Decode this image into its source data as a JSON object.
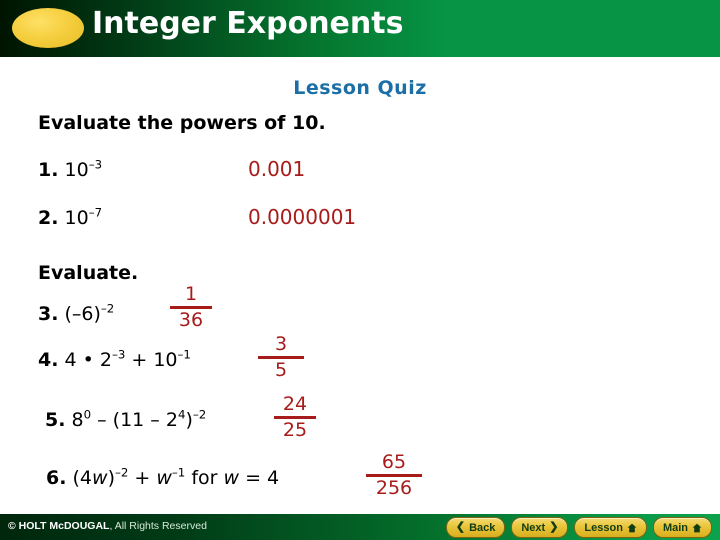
{
  "header": {
    "title": "Integer Exponents",
    "ellipse_color": "#f0c93c",
    "bar_color": "#079445"
  },
  "slide": {
    "subtitle": "Lesson Quiz",
    "subtitle_color": "#1b6fa6",
    "directions_1": "Evaluate the powers of 10.",
    "directions_2": "Evaluate.",
    "answer_color": "#a81b1b",
    "questions": [
      {
        "number": "1.",
        "expression_html": "10<sup>&#8211;3</sup>",
        "answer_type": "plain",
        "answer": "0.001"
      },
      {
        "number": "2.",
        "expression_html": "10<sup>&#8211;7</sup>",
        "answer_type": "plain",
        "answer": "0.0000001"
      },
      {
        "number": "3.",
        "expression_html": "(&#8211;6)<sup>&#8211;2</sup>",
        "answer_type": "fraction",
        "numerator": "1",
        "denominator": "36"
      },
      {
        "number": "4.",
        "expression_html": "4 &#8226; 2<sup>&#8211;3</sup> + 10<sup>&#8211;1</sup>",
        "answer_type": "fraction",
        "numerator": "3",
        "denominator": "5"
      },
      {
        "number": "5.",
        "expression_html": "8<sup>0</sup> &#8211; (11 &#8211; 2<sup>4</sup>)<sup>&#8211;2</sup>",
        "answer_type": "fraction",
        "numerator": "24",
        "denominator": "25"
      },
      {
        "number": "6.",
        "expression_html": "(4<i>w</i>)<sup>&#8211;2</sup> + <i>w</i><sup>&#8211;1</sup> for <i>w</i> = 4",
        "answer_type": "fraction",
        "numerator": "65",
        "denominator": "256"
      }
    ]
  },
  "footer": {
    "copyright_strong": "© HOLT McDOUGAL",
    "copyright_rest": ", All Rights Reserved",
    "buttons": [
      {
        "label": "Back",
        "icon": "chevron-left-icon"
      },
      {
        "label": "Next",
        "icon": "chevron-right-icon"
      },
      {
        "label": "Lesson",
        "icon": "home-icon"
      },
      {
        "label": "Main",
        "icon": "home-icon"
      }
    ],
    "button_color": "#e9c63c"
  }
}
